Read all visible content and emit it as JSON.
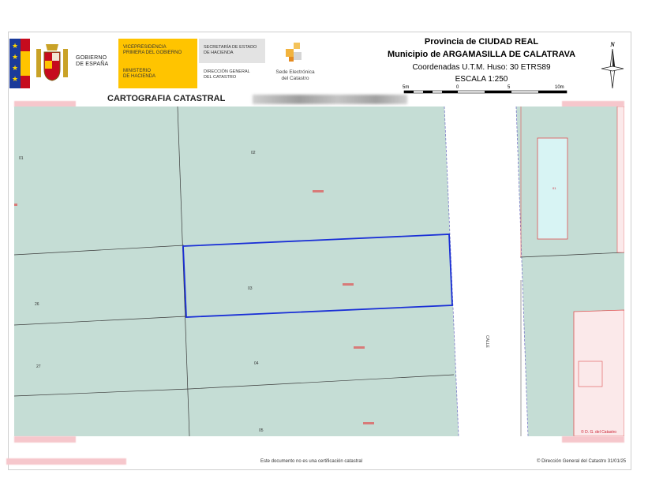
{
  "header": {
    "gov_line1": "GOBIERNO",
    "gov_line2": "DE ESPAÑA",
    "vp_line1": "VICEPRESIDENCIA",
    "vp_line2": "PRIMERA DEL GOBIERNO",
    "min_line1": "MINISTERIO",
    "min_line2": "DE HACIENDA",
    "sec_line1": "SECRETARÍA DE ESTADO",
    "sec_line2": "DE HACIENDA",
    "dgc_line1": "DIRECCIÓN GENERAL",
    "dgc_line2": "DEL CATASTRO",
    "sede_line1": "Sede Electrónica",
    "sede_line2": "del Catastro",
    "province": "Provincia de CIUDAD REAL",
    "municipality": "Municipio de ARGAMASILLA DE CALATRAVA",
    "coordinates": "Coordenadas U.T.M. Huso: 30 ETRS89",
    "scale": "ESCALA 1:250",
    "scale_left": "5m",
    "scale_mid": "0",
    "scale_5": "5",
    "scale_right": "10m",
    "north": "N",
    "title": "CARTOGRAFIA CATASTRAL"
  },
  "map": {
    "parcels": {
      "p01": "01",
      "p02": "02",
      "p03": "03",
      "p04": "04",
      "p05": "05",
      "p26": "26",
      "p27": "27",
      "right_small": "01"
    },
    "street_label": "CALLE",
    "copyright": "© D. G. del Catastro",
    "colors": {
      "parcel_fill": "#c5ddd5",
      "street": "#ffffff",
      "selected_border": "#1a2fd6",
      "pool": "#d8f4f4",
      "red_parcel": "#fbe9ea"
    }
  },
  "footer": {
    "disclaimer": "Este documento no es una certificación catastral",
    "credit": "© Dirección General del Catastro 31/01/25"
  }
}
